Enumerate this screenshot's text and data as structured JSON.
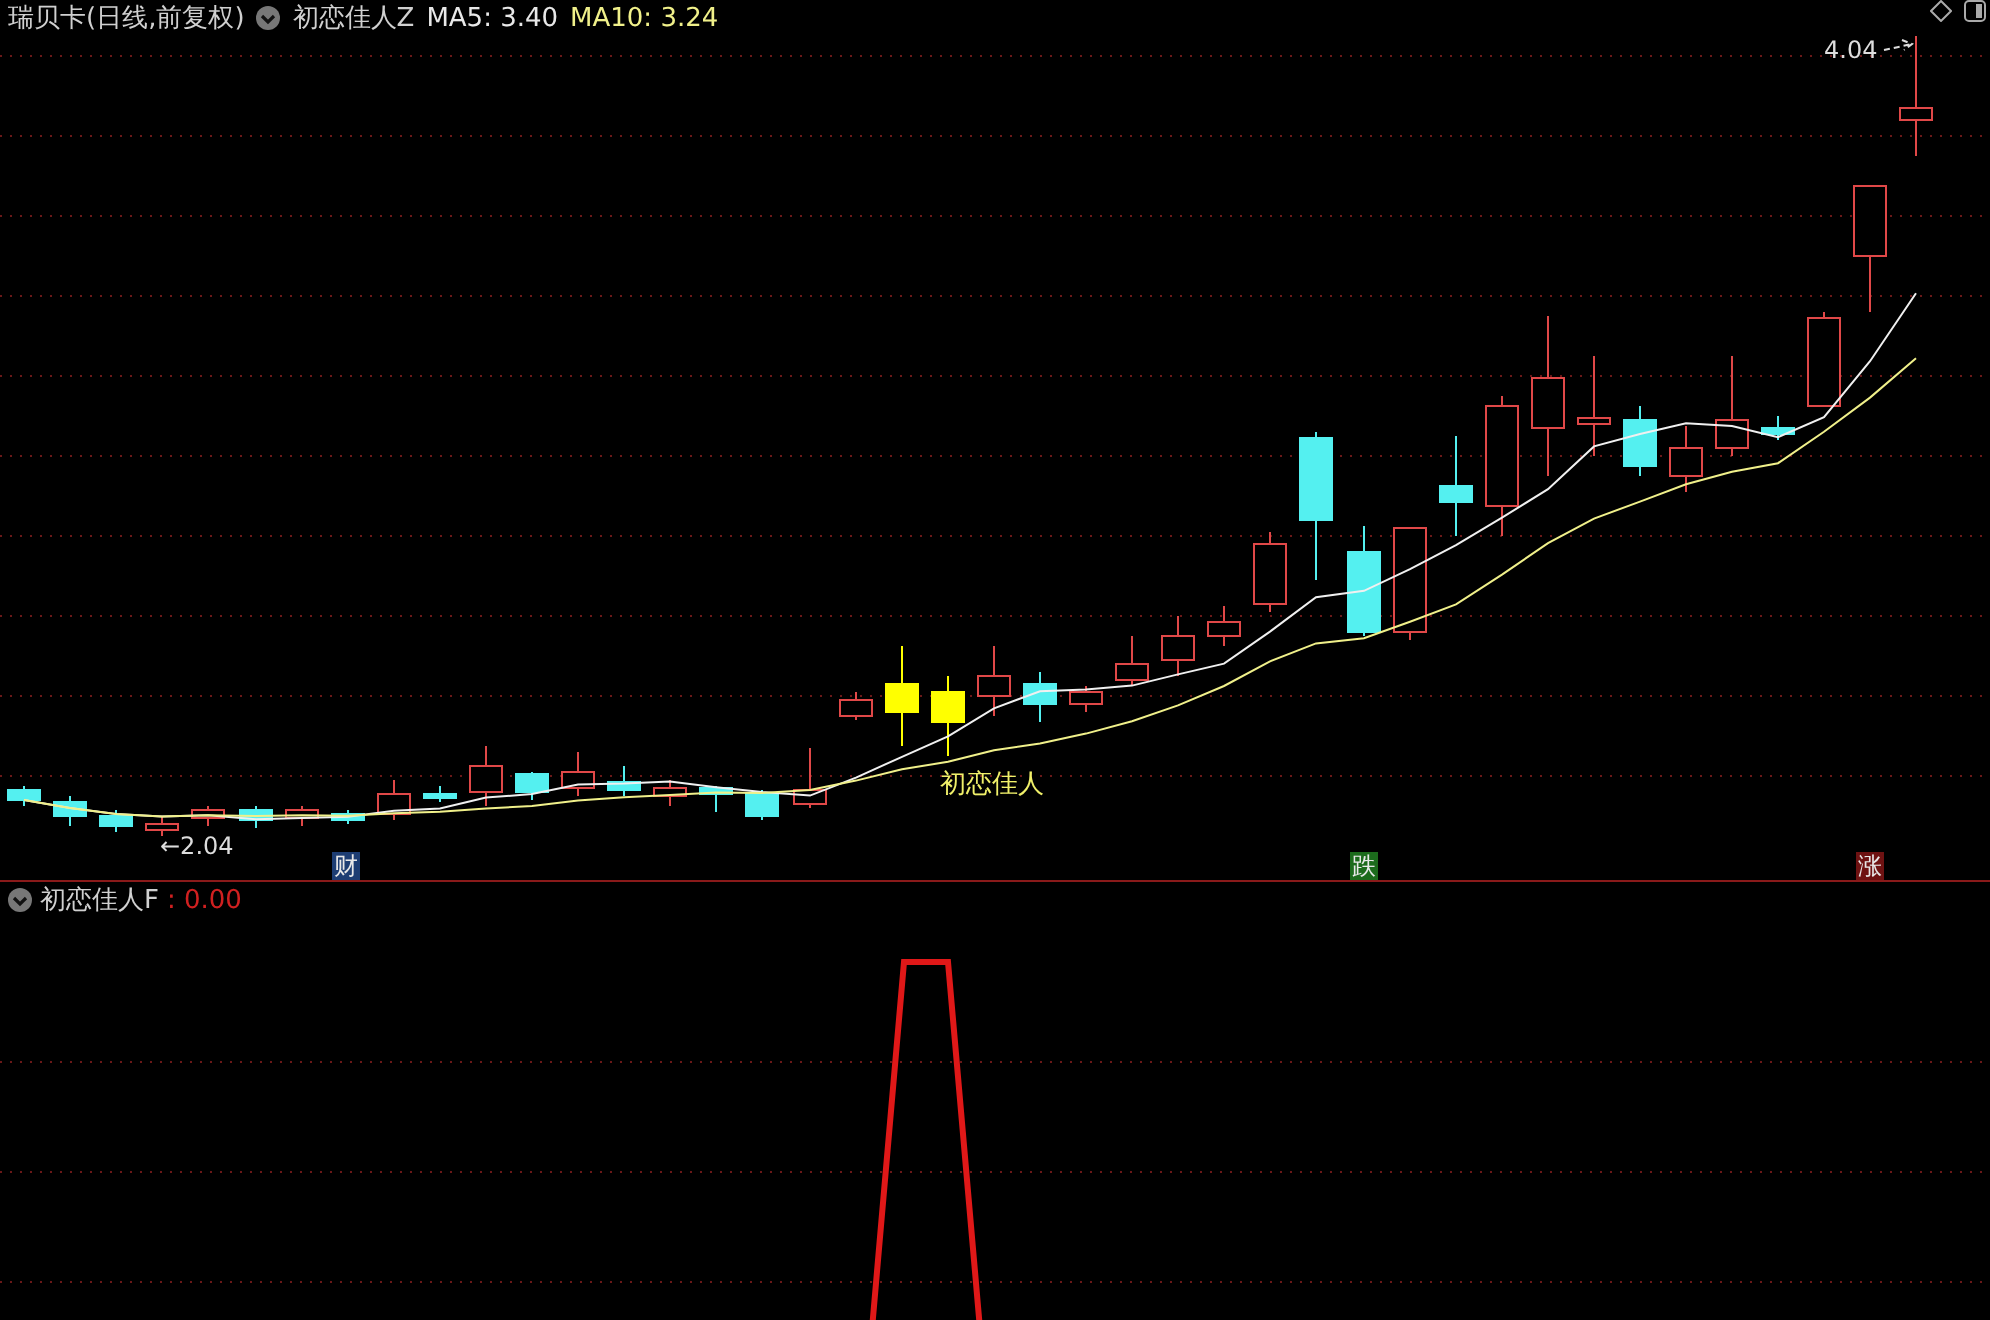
{
  "header": {
    "stock": "瑞贝卡(日线,前复权)",
    "indicator": "初恋佳人Z",
    "ma5": "MA5: 3.40",
    "ma10": "MA10: 3.24"
  },
  "main_chart": {
    "high_label": "4.04",
    "low_label": "←2.04",
    "signal_label": "初恋佳人",
    "markers": [
      {
        "text": "财",
        "kind": "info"
      },
      {
        "text": "跌",
        "kind": "fall"
      },
      {
        "text": "涨",
        "kind": "rise"
      }
    ]
  },
  "sub_panel": {
    "indicator": "初恋佳人F",
    "value": ": 0.00"
  }
}
